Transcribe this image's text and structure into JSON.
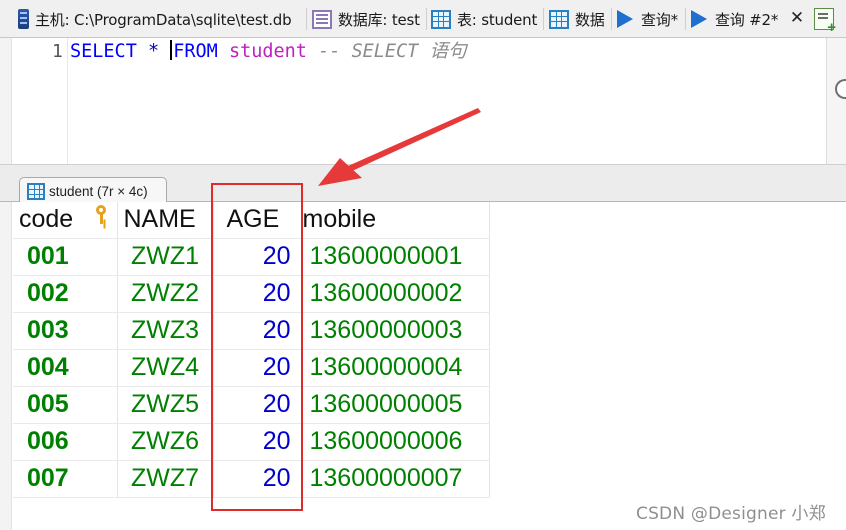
{
  "tabs": [
    {
      "label": "主机: C:\\ProgramData\\sqlite\\test.db",
      "icon": "database-connection-icon"
    },
    {
      "label": "数据库: test",
      "icon": "database-icon"
    },
    {
      "label": "表: student",
      "icon": "table-icon"
    },
    {
      "label": "数据",
      "icon": "data-grid-icon"
    },
    {
      "label": "查询*",
      "icon": "run-query-icon"
    },
    {
      "label": "查询 #2*",
      "icon": "run-query-icon"
    }
  ],
  "tab_close_glyph": "✕",
  "editor": {
    "line_number": "1",
    "kw_select": "SELECT",
    "star": "*",
    "kw_from": "FROM",
    "table": "student",
    "comment": "-- SELECT 语句"
  },
  "result_tab": {
    "label": "student (7r × 4c)"
  },
  "grid": {
    "columns": [
      "code",
      "NAME",
      "AGE",
      "mobile"
    ],
    "primary_key_column": "code",
    "rows": [
      {
        "code": "001",
        "name": "ZWZ1",
        "age": "20",
        "mobile": "13600000001"
      },
      {
        "code": "002",
        "name": "ZWZ2",
        "age": "20",
        "mobile": "13600000002"
      },
      {
        "code": "003",
        "name": "ZWZ3",
        "age": "20",
        "mobile": "13600000003"
      },
      {
        "code": "004",
        "name": "ZWZ4",
        "age": "20",
        "mobile": "13600000004"
      },
      {
        "code": "005",
        "name": "ZWZ5",
        "age": "20",
        "mobile": "13600000005"
      },
      {
        "code": "006",
        "name": "ZWZ6",
        "age": "20",
        "mobile": "13600000006"
      },
      {
        "code": "007",
        "name": "ZWZ7",
        "age": "20",
        "mobile": "13600000007"
      }
    ]
  },
  "annotation": {
    "color": "#e02b2b",
    "highlighted_column": "AGE"
  },
  "watermark": "CSDN @Designer 小郑",
  "colors": {
    "keyword": "#0000ff",
    "table_name": "#c020c0",
    "comment": "#8c8c8c",
    "text_value": "#008000",
    "number_value": "#0000cc"
  }
}
